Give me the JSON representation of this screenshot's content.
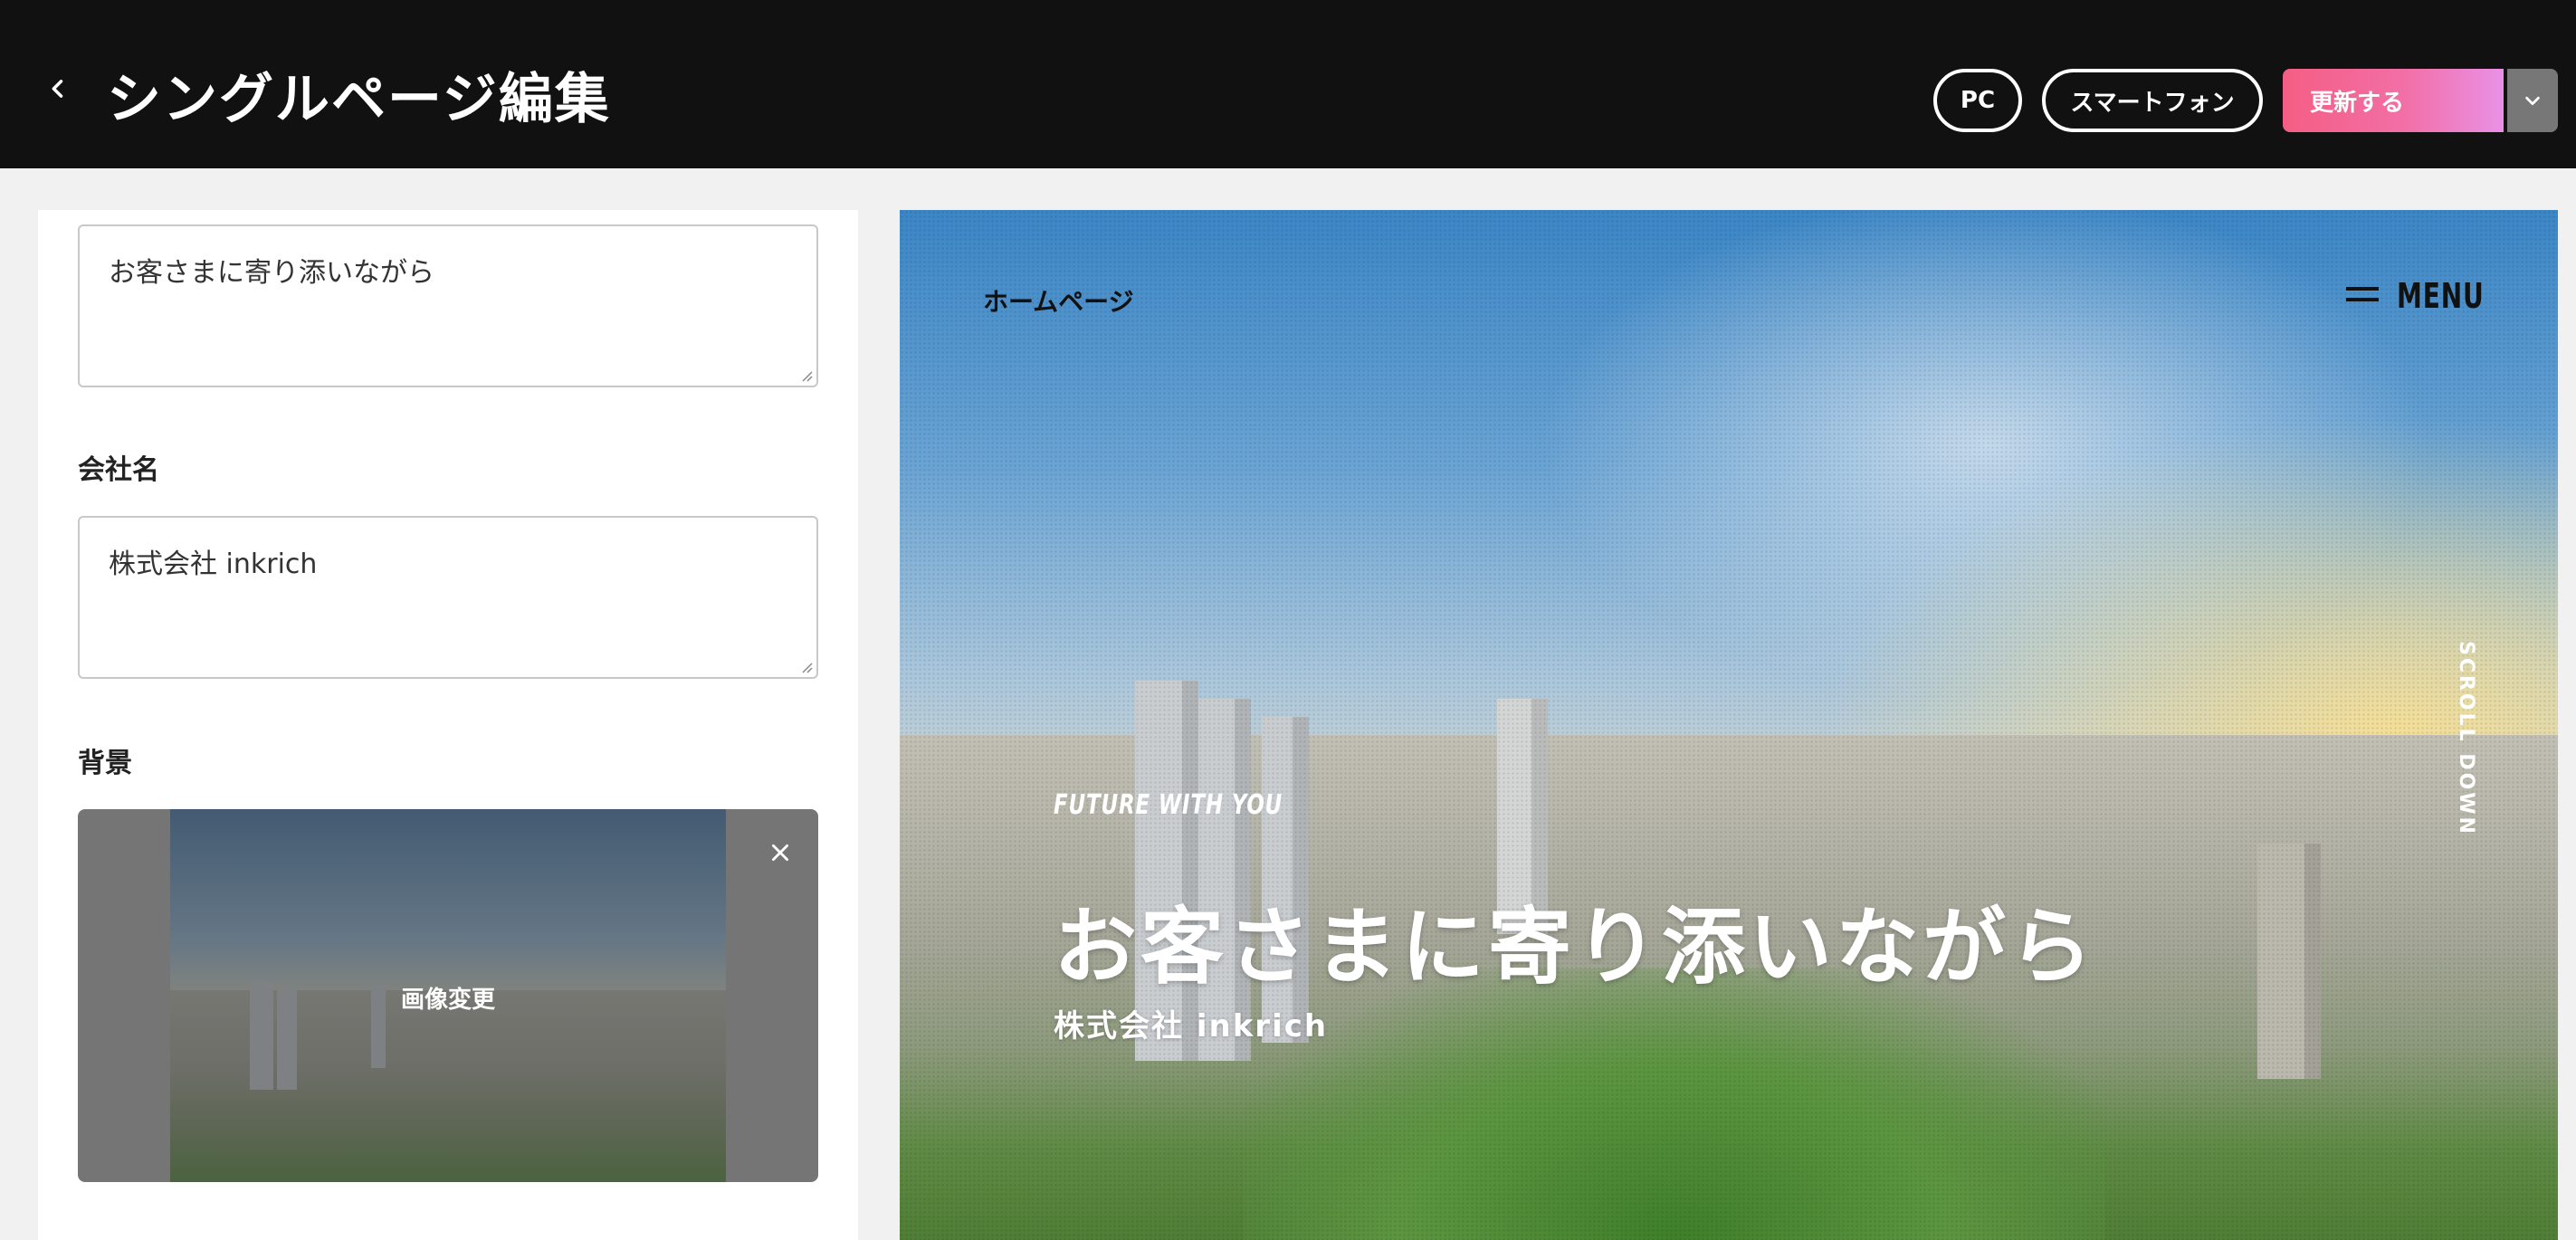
{
  "header": {
    "title": "シングルページ編集",
    "view_pc": "PC",
    "view_smartphone": "スマートフォン",
    "update_label": "更新する"
  },
  "editor": {
    "catch_copy_value": "お客さまに寄り添いながら",
    "company_label": "会社名",
    "company_value": "株式会社 inkrich",
    "background_label": "背景",
    "change_image_label": "画像変更"
  },
  "preview": {
    "home_link": "ホームページ",
    "menu_label": "MENU",
    "scroll_label": "SCROLL DOWN",
    "tagline": "FUTURE WITH YOU",
    "headline": "お客さまに寄り添いながら",
    "company": "株式会社 inkrich"
  },
  "colors": {
    "header_bg": "#111111",
    "update_gradient_start": "#f45e84",
    "update_gradient_end": "#e991e6",
    "dropdown_bg": "#777777"
  },
  "icons": {
    "back": "chevron-left-icon",
    "dropdown": "chevron-down-icon",
    "remove_image": "close-icon",
    "menu": "hamburger-icon"
  }
}
